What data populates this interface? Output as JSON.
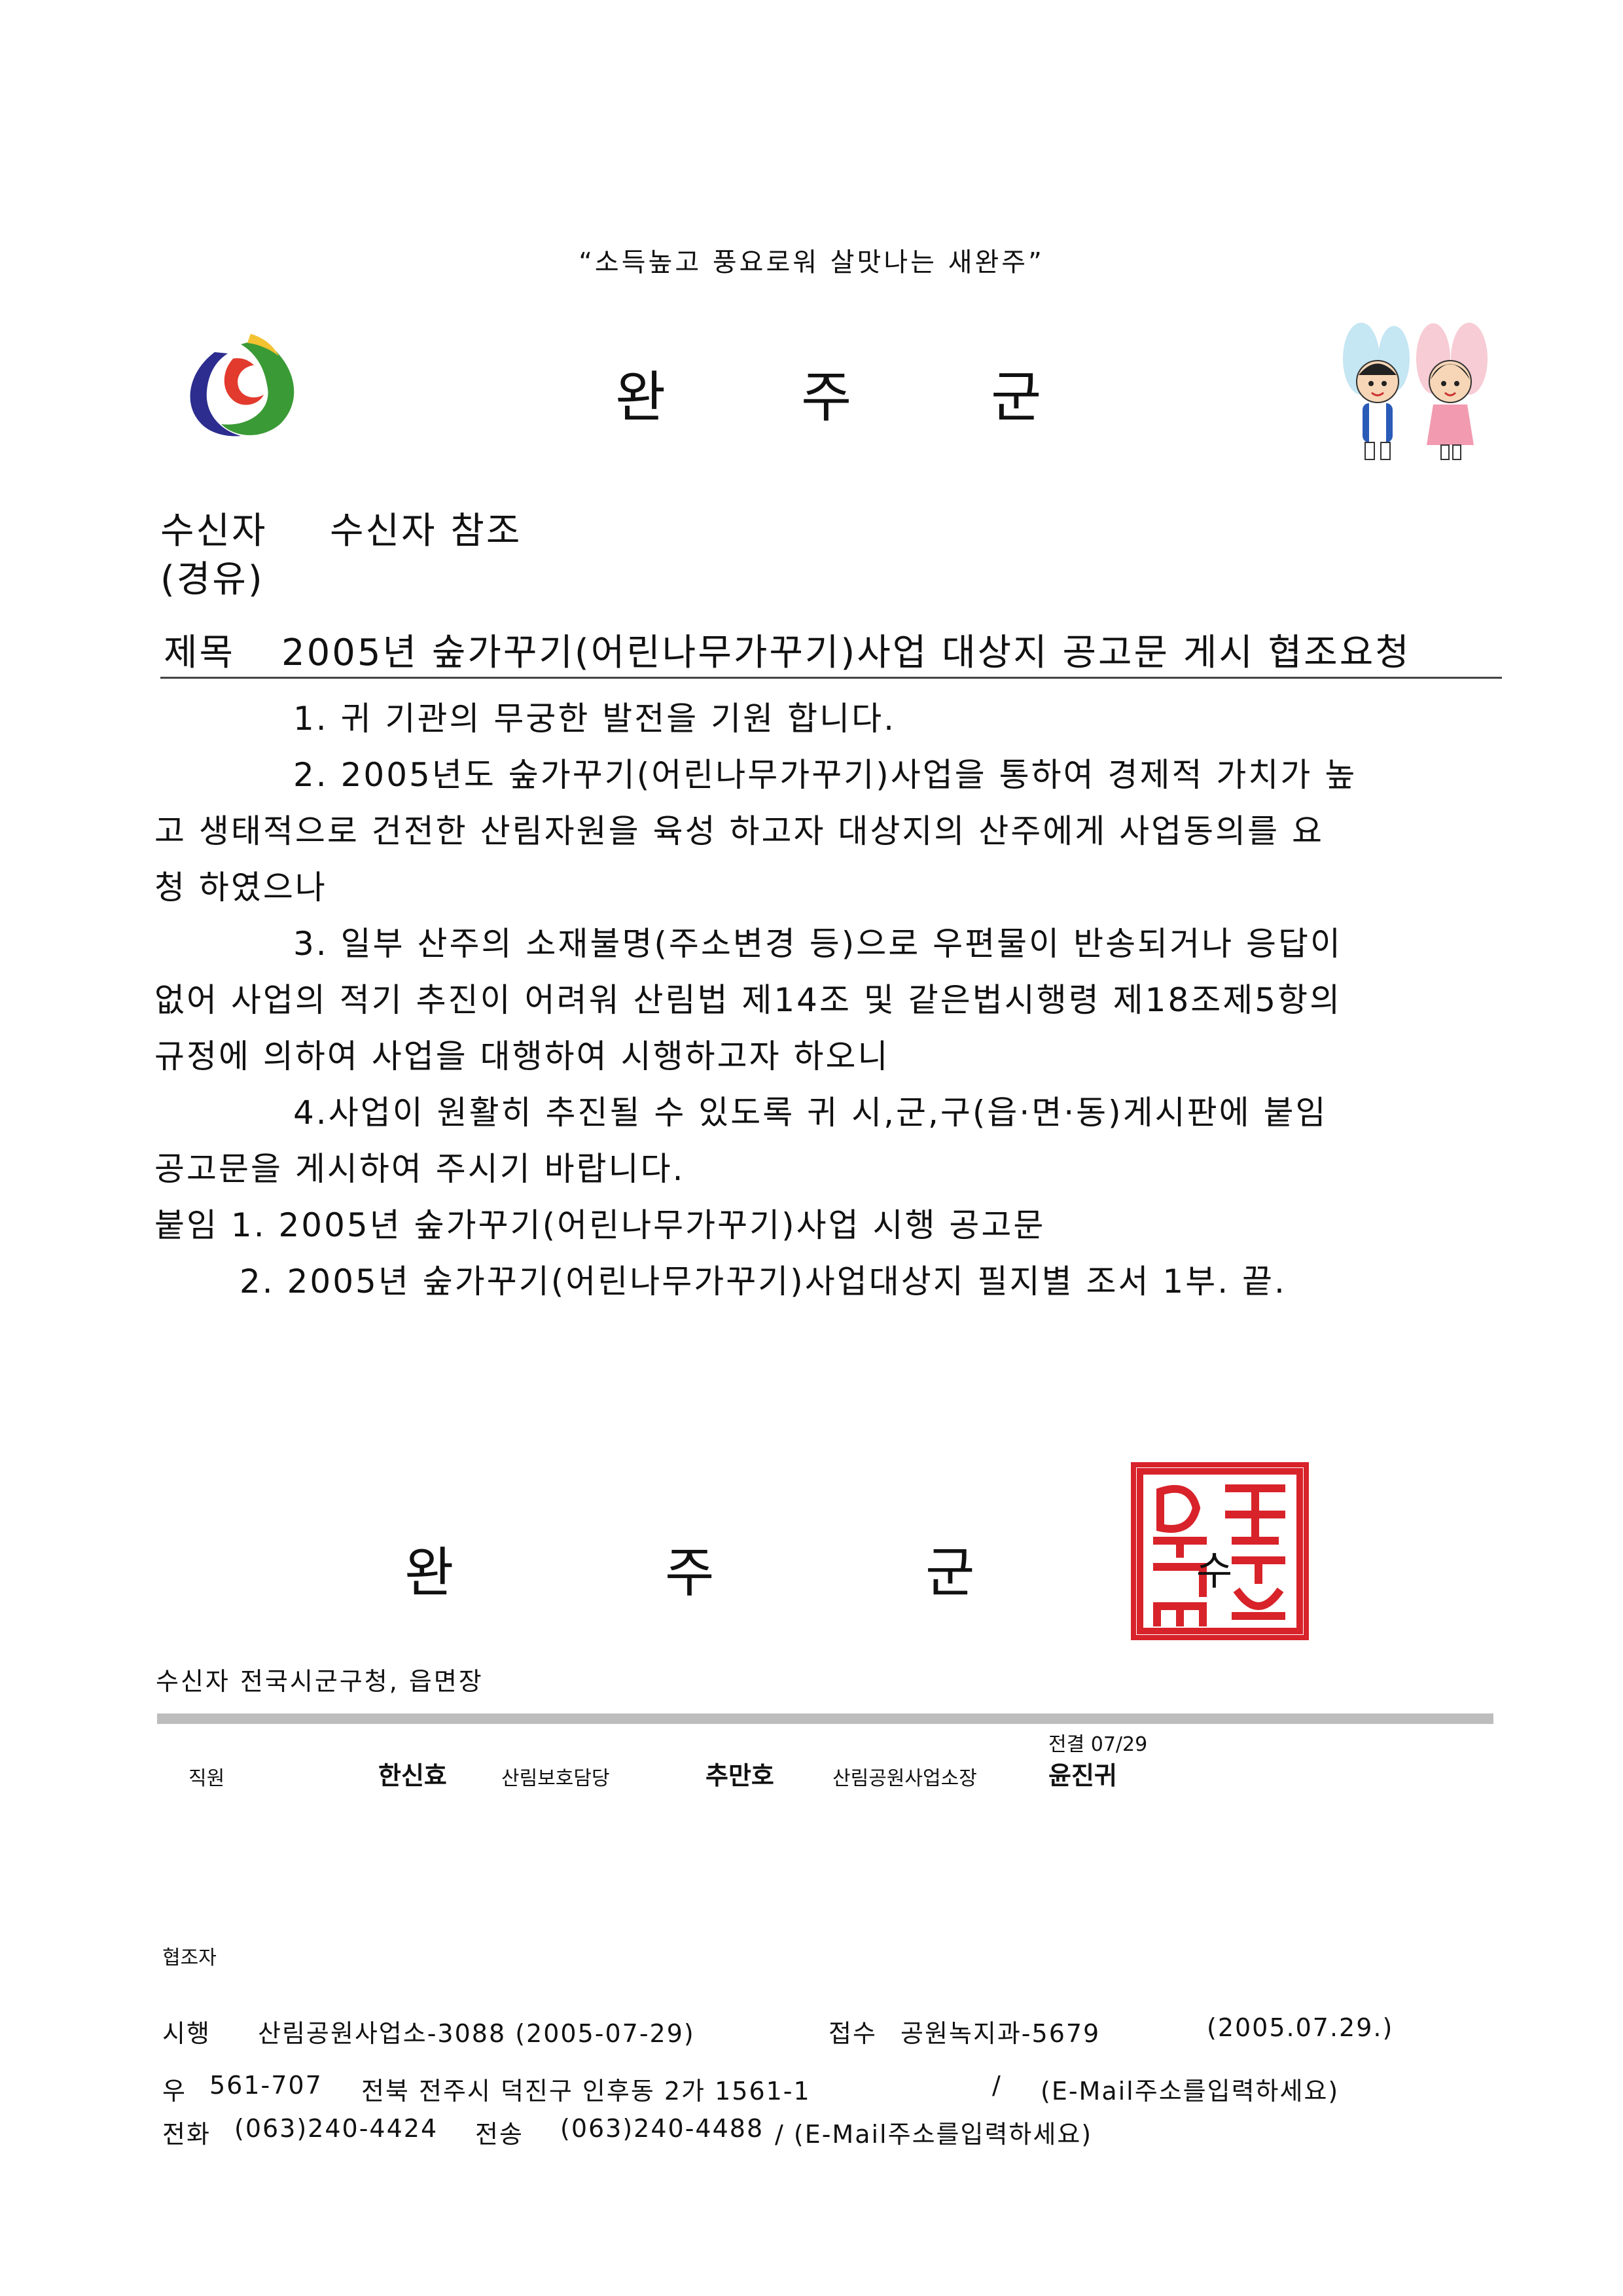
{
  "header": {
    "slogan": "“소득높고 풍요로워 살맛나는 새완주”",
    "org_chars": [
      "완",
      "주",
      "군"
    ]
  },
  "recipient": {
    "label": "수신자",
    "value": "수신자 참조",
    "via_label": "(경유)"
  },
  "subject": {
    "label": "제목",
    "value": "2005년 숲가꾸기(어린나무가꾸기)사업 대상지 공고문 게시 협조요청"
  },
  "body_lines": [
    "1. 귀 기관의 무궁한 발전을 기원 합니다.",
    "2. 2005년도 숲가꾸기(어린나무가꾸기)사업을 통하여 경제적 가치가 높",
    "고 생태적으로 건전한 산림자원을 육성 하고자 대상지의 산주에게 사업동의를 요",
    "청 하였으나",
    "3. 일부 산주의 소재불명(주소변경 등)으로 우편물이 반송되거나 응답이",
    "없어 사업의 적기 추진이 어려워 산림법 제14조 및 같은법시행령  제18조제5항의",
    "규정에 의하여 사업을 대행하여 시행하고자 하오니",
    "4.사업이 원활히 추진될 수 있도록 귀 시,군,구(읍·면·동)게시판에 붙임",
    "공고문을 게시하여 주시기 바랍니다.",
    "붙임 1. 2005년 숲가꾸기(어린나무가꾸기)사업 시행 공고문",
    "2. 2005년 숲가꾸기(어린나무가꾸기)사업대상지 필지별 조서 1부. 끝."
  ],
  "signature": {
    "chars": [
      "완",
      "주",
      "군"
    ],
    "seal_chars": [
      "완",
      "주",
      "군",
      "수"
    ],
    "seal_color": "#d8232a"
  },
  "recipients_line": "수신자 전국시군구청, 읍면장",
  "approval": {
    "staff_title": "직원",
    "staff_name": "한신효",
    "mid_title": "산림보호담당",
    "mid_name": "추만호",
    "head_title": "산림공원사업소장",
    "head_note": "전결 07/29",
    "head_name": "윤진귀"
  },
  "cooperator_label": "협조자",
  "footer": {
    "enforce_label": "시행",
    "enforce_value": "산림공원사업소-3088 (2005-07-29)",
    "receipt_label": "접수",
    "receipt_value": "공원녹지과-5679",
    "receipt_date": "(2005.07.29.)",
    "zip_label": "우",
    "zip": "561-707",
    "address": "전북 전주시 덕진구 인후동 2가 1561-1",
    "slash": "/",
    "email_placeholder_1": "(E-Mail주소를입력하세요)",
    "phone_label": "전화",
    "phone": "(063)240-4424",
    "fax_label": "전송",
    "fax": "(063)240-4488",
    "email_placeholder_2": "/ (E-Mail주소를입력하세요)"
  }
}
